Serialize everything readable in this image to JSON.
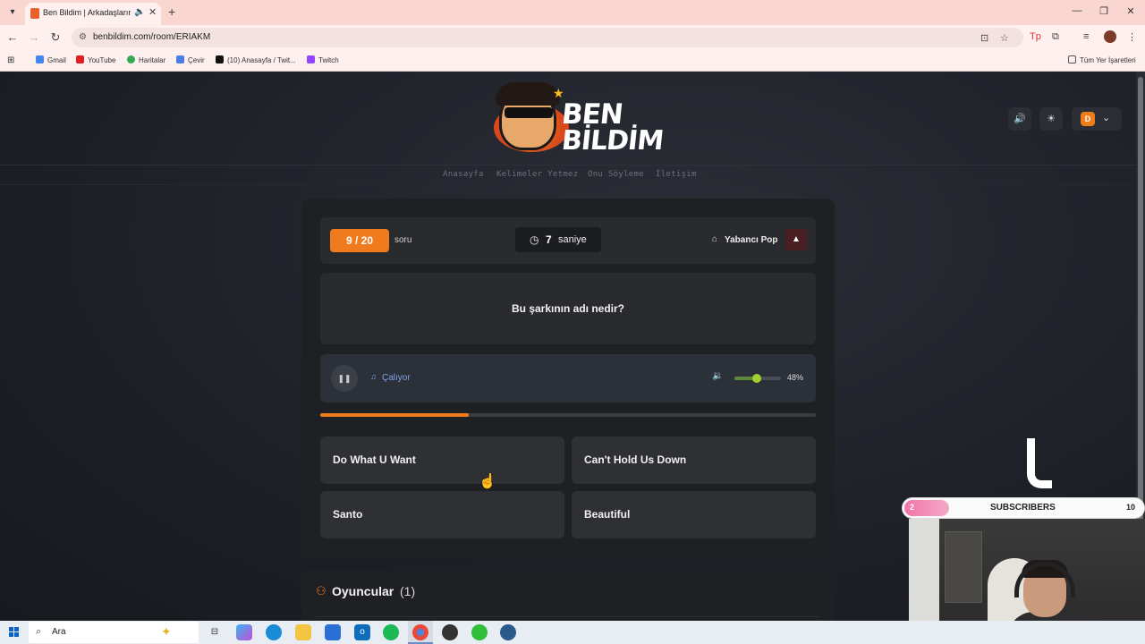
{
  "browser": {
    "tab_title": "Ben Bildim | Arkadaşlarınla",
    "url": "benbildim.com/room/ERIAKM",
    "bookmarks": [
      "Gmail",
      "YouTube",
      "Haritalar",
      "Çevir",
      "(10) Anasayfa / Twit...",
      "Twitch"
    ],
    "bookmarks_folder": "Tüm Yer İşaretleri"
  },
  "site": {
    "logo_line1": "BEN",
    "logo_line2": "BİLDİM",
    "nav": [
      "Anasayfa",
      "Kelimeler Yetmez",
      "Onu Söyleme",
      "İletişim"
    ],
    "user_initial": "D"
  },
  "game": {
    "question_counter": "9 / 20",
    "question_word": "soru",
    "timer_value": "7",
    "timer_unit": "saniye",
    "category": "Yabancı Pop",
    "question_text": "Bu şarkının adı nedir?",
    "player_status": "Çalıyor",
    "volume_label": "48%",
    "volume_fraction": 0.48,
    "progress_fraction": 0.3,
    "answers": [
      "Do What U Want",
      "Can't Hold Us Down",
      "Santo",
      "Beautiful"
    ]
  },
  "players": {
    "title": "Oyuncular",
    "count": "(1)"
  },
  "overlay": {
    "subs_current": "2",
    "subs_label": "SUBSCRIBERS",
    "subs_goal": "10"
  },
  "taskbar": {
    "search_label": "Ara"
  },
  "colors": {
    "accent": "#f07b1d",
    "page_bg": "#1d2027",
    "card_bg": "#1f2024",
    "status_blue": "#7fa4e6",
    "volume_green": "#a0d22e"
  }
}
